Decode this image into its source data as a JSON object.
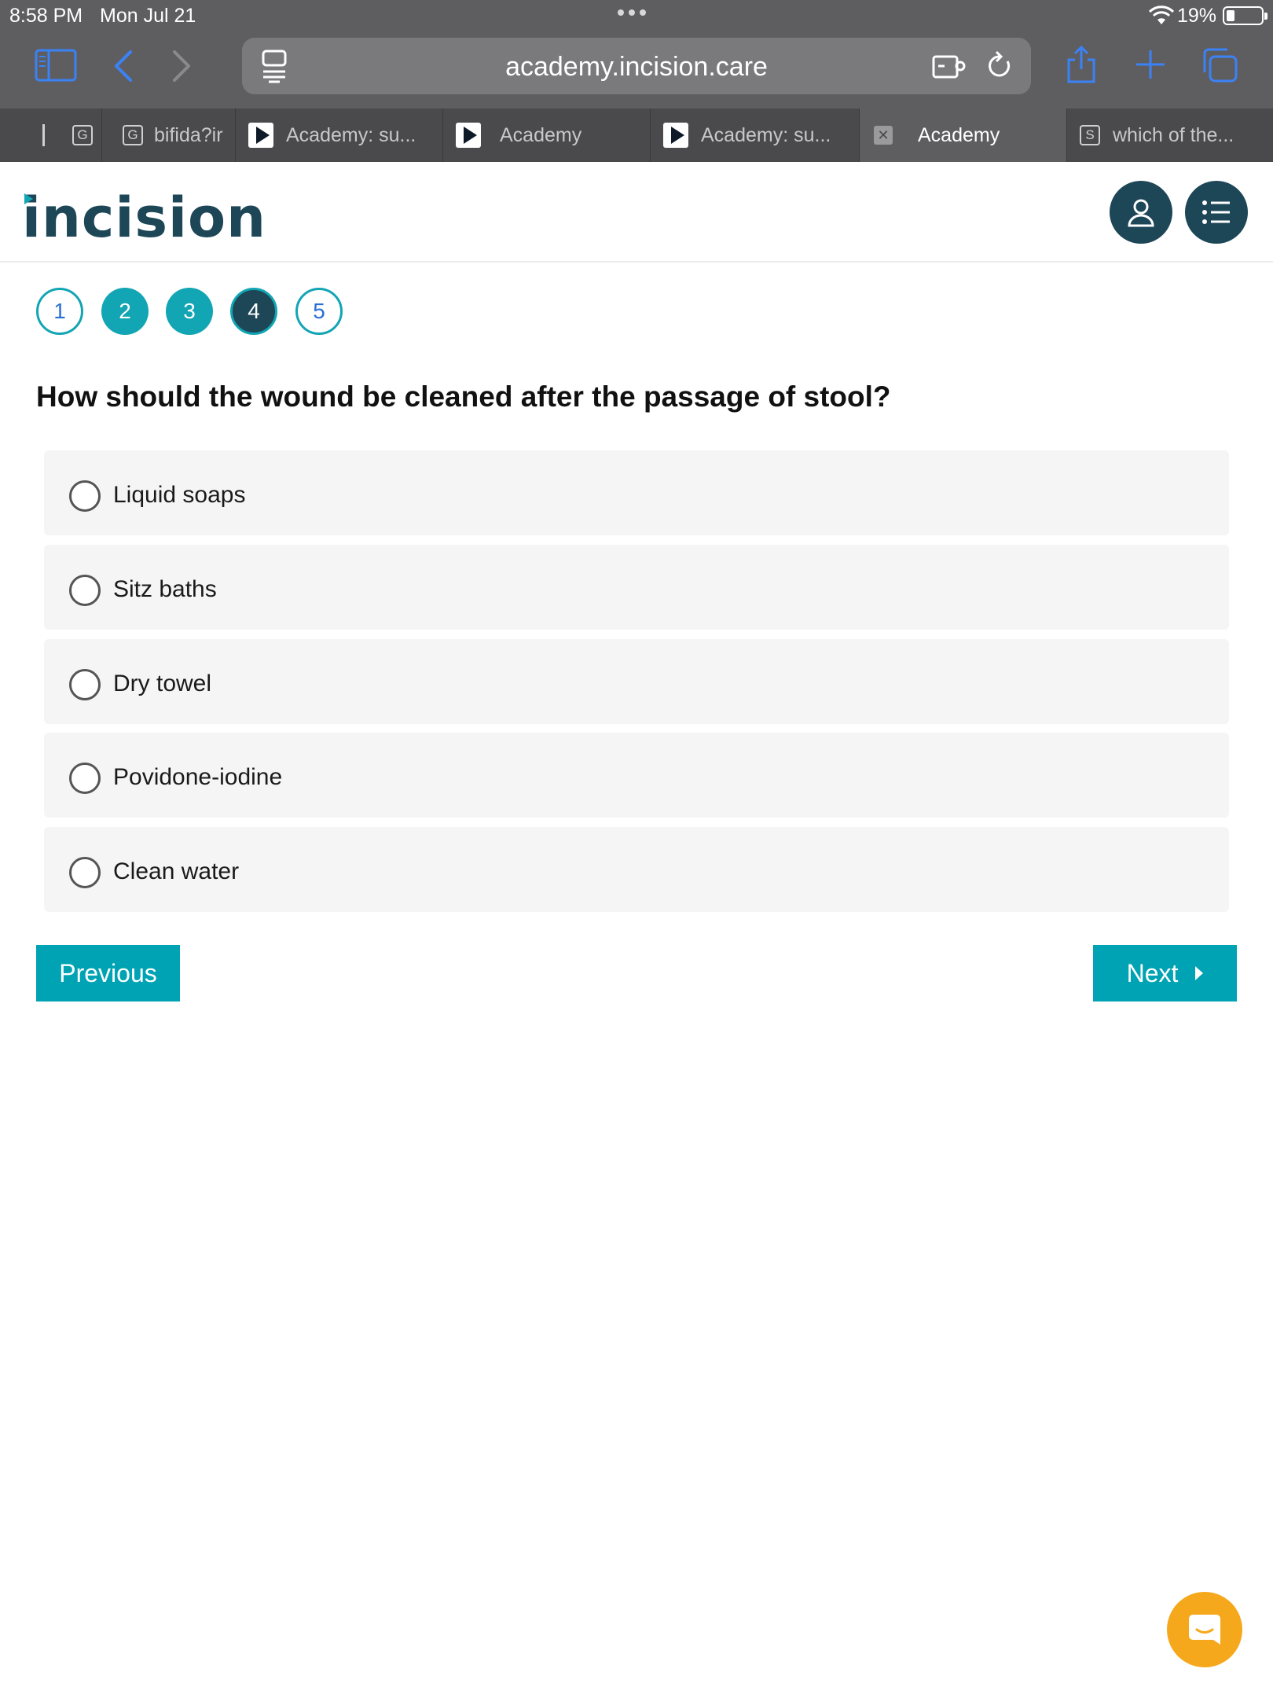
{
  "status_bar": {
    "time": "8:58 PM",
    "date": "Mon Jul 21",
    "battery_percent": "19%",
    "battery_level": 0.19
  },
  "browser": {
    "url": "academy.incision.care",
    "accent_color": "#3b82f6",
    "tabs": [
      {
        "favicon": "G",
        "label": ""
      },
      {
        "favicon": "G",
        "label": "bifida?ir"
      },
      {
        "favicon": "play-icon",
        "label": "Academy: su..."
      },
      {
        "favicon": "play-icon",
        "label": "Academy"
      },
      {
        "favicon": "play-icon",
        "label": "Academy: su..."
      },
      {
        "favicon": "close-icon",
        "label": "Academy",
        "active": true
      },
      {
        "favicon": "S",
        "label": "which of the..."
      }
    ]
  },
  "site": {
    "logo_text": "incision",
    "brand_color": "#1d4657",
    "accent_color": "#00a3b4"
  },
  "quiz": {
    "steps": [
      {
        "label": "1",
        "state": "outline"
      },
      {
        "label": "2",
        "state": "done"
      },
      {
        "label": "3",
        "state": "done"
      },
      {
        "label": "4",
        "state": "current"
      },
      {
        "label": "5",
        "state": "outline"
      }
    ],
    "question": "How should the wound be cleaned after the passage of stool?",
    "options": [
      {
        "label": "Liquid soaps"
      },
      {
        "label": "Sitz baths"
      },
      {
        "label": "Dry towel"
      },
      {
        "label": "Povidone-iodine"
      },
      {
        "label": "Clean water"
      }
    ],
    "previous_label": "Previous",
    "next_label": "Next"
  }
}
